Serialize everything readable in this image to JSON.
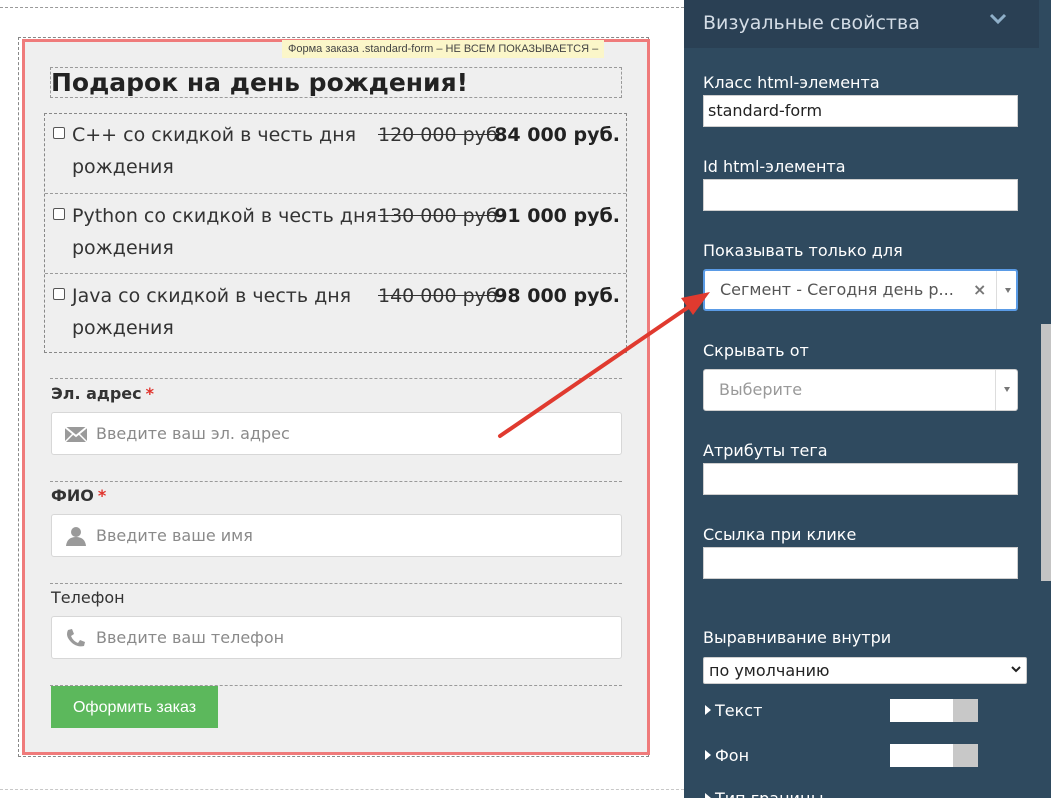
{
  "form": {
    "tag_label": "Форма заказа .standard-form – НЕ ВСЕМ ПОКАЗЫВАЕТСЯ –",
    "title": "Подарок на день рождения!",
    "offers": [
      {
        "name": "C++ со скидкой в честь дня рождения",
        "old_price": "120 000 руб.",
        "new_price": "84 000 руб."
      },
      {
        "name": "Python со скидкой в честь дня рождения",
        "old_price": "130 000 руб.",
        "new_price": "91 000 руб."
      },
      {
        "name": "Java со скидкой в честь дня рождения",
        "old_price": "140 000 руб.",
        "new_price": "98 000 руб."
      }
    ],
    "email": {
      "label": "Эл. адрес",
      "required_mark": "*",
      "placeholder": "Введите ваш эл. адрес",
      "icon": "envelope-icon"
    },
    "name": {
      "label": "ФИО",
      "required_mark": "*",
      "placeholder": "Введите ваше имя",
      "icon": "user-icon"
    },
    "phone": {
      "label": "Телефон",
      "placeholder": "Введите ваш телефон",
      "icon": "phone-icon"
    },
    "submit_label": "Оформить заказ"
  },
  "panel": {
    "title": "Визуальные свойства",
    "class_label": "Класс html-элемента",
    "class_value": "standard-form",
    "id_label": "Id html-элемента",
    "id_value": "",
    "show_only_label": "Показывать только для",
    "show_only_value": "Сегмент - Сегодня день р...",
    "hide_from_label": "Скрывать от",
    "hide_from_placeholder": "Выберите",
    "tag_attrs_label": "Атрибуты тега",
    "tag_attrs_value": "",
    "click_link_label": "Ссылка при клике",
    "click_link_value": "",
    "align_label": "Выравнивание внутри",
    "align_value": "по умолчанию",
    "text_toggle": "Текст",
    "bg_toggle": "Фон",
    "clipped_next": "Тип границы"
  },
  "colors": {
    "panel_bg": "#2f4a5f",
    "form_border": "#ef7b7b",
    "submit_bg": "#5cb85c",
    "required": "#e0322b",
    "arrow": "#e03a2f"
  }
}
